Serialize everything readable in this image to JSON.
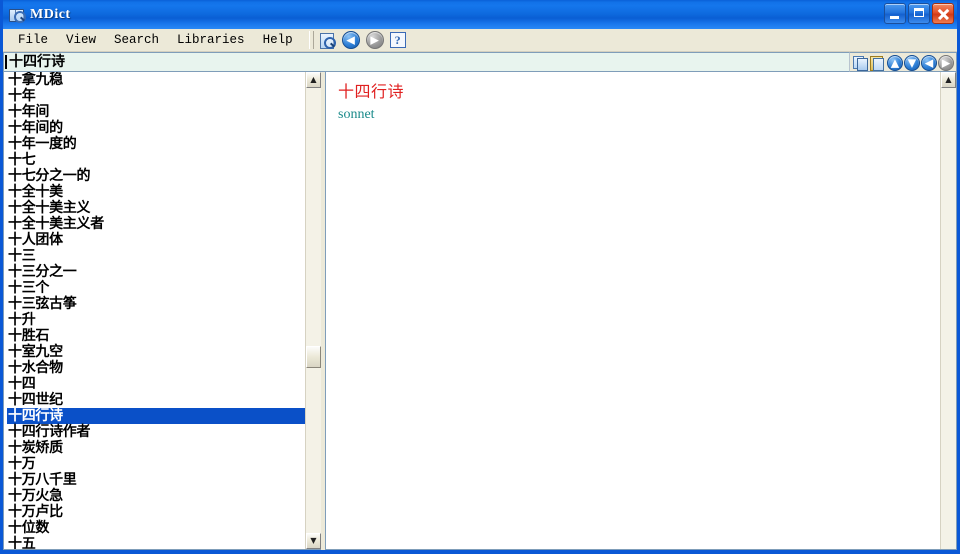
{
  "window": {
    "title": "MDict",
    "icon": "dictionary-magnifier-icon",
    "minimize_label": "Minimize",
    "maximize_label": "Maximize",
    "close_label": "Close"
  },
  "menubar": {
    "items": [
      {
        "label": "File"
      },
      {
        "label": "View"
      },
      {
        "label": "Search"
      },
      {
        "label": "Libraries"
      },
      {
        "label": "Help"
      }
    ],
    "tools": [
      {
        "name": "find-icon",
        "label": "Find"
      },
      {
        "name": "back-icon",
        "label": "Back",
        "glyph": "◀",
        "enabled": true
      },
      {
        "name": "forward-icon",
        "label": "Forward",
        "glyph": "▶",
        "enabled": false
      },
      {
        "name": "help-icon",
        "label": "?",
        "glyph": "?"
      }
    ]
  },
  "search": {
    "value": "十四行诗",
    "placeholder": "",
    "tools": [
      {
        "name": "copy-icon",
        "label": "Copy"
      },
      {
        "name": "paste-icon",
        "label": "Paste"
      },
      {
        "name": "scroll-up-icon",
        "label": "Previous",
        "glyph": "▲",
        "enabled": true
      },
      {
        "name": "scroll-down-icon",
        "label": "Next",
        "glyph": "▼",
        "enabled": true
      },
      {
        "name": "history-back-icon",
        "label": "Back",
        "glyph": "◀",
        "enabled": true
      },
      {
        "name": "history-forward-icon",
        "label": "Forward",
        "glyph": "▶",
        "enabled": false
      }
    ]
  },
  "word_list": {
    "selected_index": 21,
    "items": [
      {
        "label": "十拿九稳"
      },
      {
        "label": "十年"
      },
      {
        "label": "十年间"
      },
      {
        "label": "十年间的"
      },
      {
        "label": "十年一度的"
      },
      {
        "label": "十七"
      },
      {
        "label": "十七分之一的"
      },
      {
        "label": "十全十美"
      },
      {
        "label": "十全十美主义"
      },
      {
        "label": "十全十美主义者"
      },
      {
        "label": "十人团体"
      },
      {
        "label": "十三"
      },
      {
        "label": "十三分之一"
      },
      {
        "label": "十三个"
      },
      {
        "label": "十三弦古筝"
      },
      {
        "label": "十升"
      },
      {
        "label": "十胜石"
      },
      {
        "label": "十室九空"
      },
      {
        "label": "十水合物"
      },
      {
        "label": "十四"
      },
      {
        "label": "十四世纪"
      },
      {
        "label": "十四行诗"
      },
      {
        "label": "十四行诗作者"
      },
      {
        "label": "十炭矫质"
      },
      {
        "label": "十万"
      },
      {
        "label": "十万八千里"
      },
      {
        "label": "十万火急"
      },
      {
        "label": "十万卢比"
      },
      {
        "label": "十位数"
      },
      {
        "label": "十五"
      }
    ]
  },
  "list_scrollbar": {
    "up_glyph": "▲",
    "down_glyph": "▼",
    "thumb_top_pct": 58,
    "thumb_height_pct": 5
  },
  "content_scrollbar": {
    "up_glyph": "▲",
    "down_glyph": "▼",
    "thumb_top_pct": 0,
    "thumb_height_pct": 0
  },
  "entry": {
    "headword": "十四行诗",
    "definition": "sonnet",
    "headword_color": "#e02020",
    "definition_color": "#1a8a8a"
  },
  "colors": {
    "titlebar_blue": "#0a5ed4",
    "selection_blue": "#0a50c8",
    "window_face": "#ece9d8",
    "search_field_bg": "#e8f4ee"
  }
}
